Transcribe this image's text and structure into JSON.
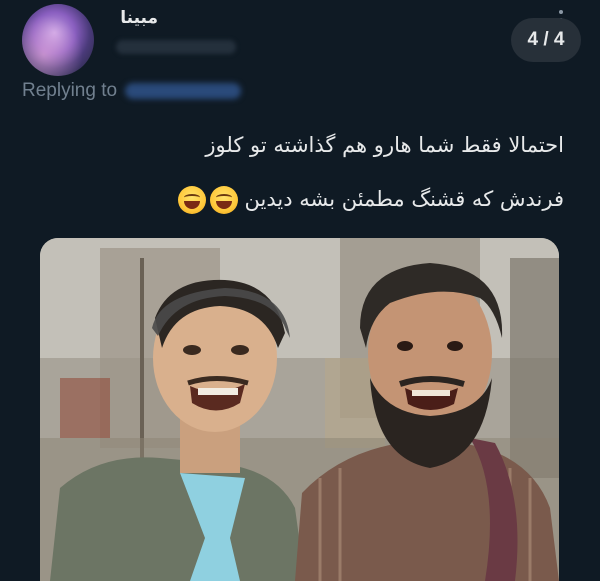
{
  "post": {
    "display_name": "مبینا",
    "replying_label": "Replying to",
    "text_line_1": "احتمالا فقط شما هارو هم گذاشته تو کلوز",
    "text_line_2": "فرندش که قشنگ مطمئن بشه دیدین",
    "emojis": [
      "grinning-squinting-face",
      "grinning-squinting-face"
    ]
  },
  "media": {
    "counter": "4 / 4"
  },
  "colors": {
    "background": "#0f1a24",
    "text": "#e7e9ea",
    "muted": "#71808f",
    "counter_bg": "#273039"
  }
}
